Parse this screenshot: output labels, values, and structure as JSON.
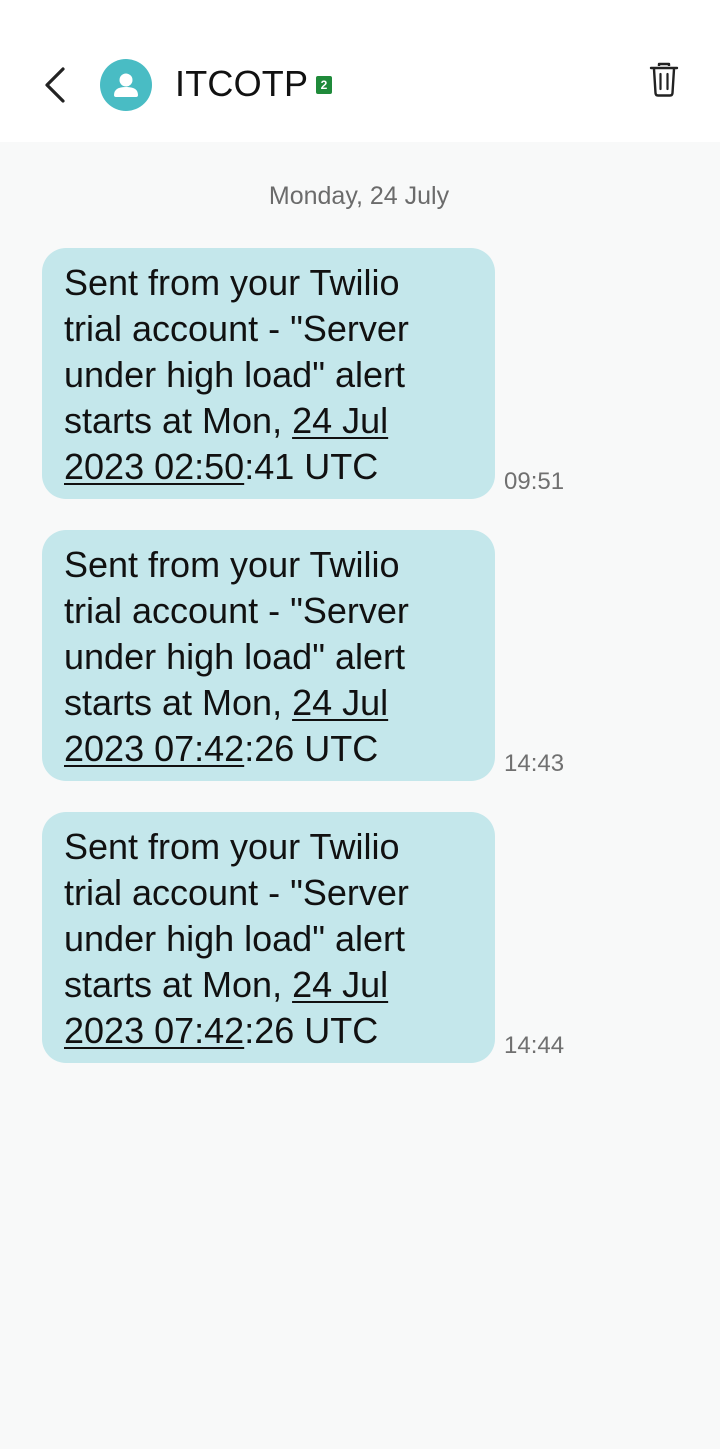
{
  "header": {
    "back_icon": "chevron-left-icon",
    "avatar_icon": "person-icon",
    "contact_name": "ITCOTP",
    "sim_badge": "2",
    "delete_icon": "trash-icon",
    "colors": {
      "avatar": "#49bcc4",
      "sim_badge": "#1f8a3a"
    }
  },
  "conversation": {
    "date_label": "Monday, 24 July",
    "bubble_color": "#c4e7eb",
    "messages": [
      {
        "lines": [
          "Sent from your Twilio",
          "trial account - \"Server",
          "under high load\" alert",
          "starts at Mon, "
        ],
        "link_a": "24 Jul",
        "link_b": "2023 02:50",
        "tail": ":41 UTC",
        "time": "09:51"
      },
      {
        "lines": [
          "Sent from your Twilio",
          "trial account - \"Server",
          "under high load\" alert",
          "starts at Mon, "
        ],
        "link_a": "24 Jul",
        "link_b": "2023 07:42",
        "tail": ":26 UTC",
        "time": "14:43"
      },
      {
        "lines": [
          "Sent from your Twilio",
          "trial account - \"Server",
          "under high load\" alert",
          "starts at Mon, "
        ],
        "link_a": "24 Jul",
        "link_b": "2023 07:42",
        "tail": ":26 UTC",
        "time": "14:44"
      }
    ]
  }
}
